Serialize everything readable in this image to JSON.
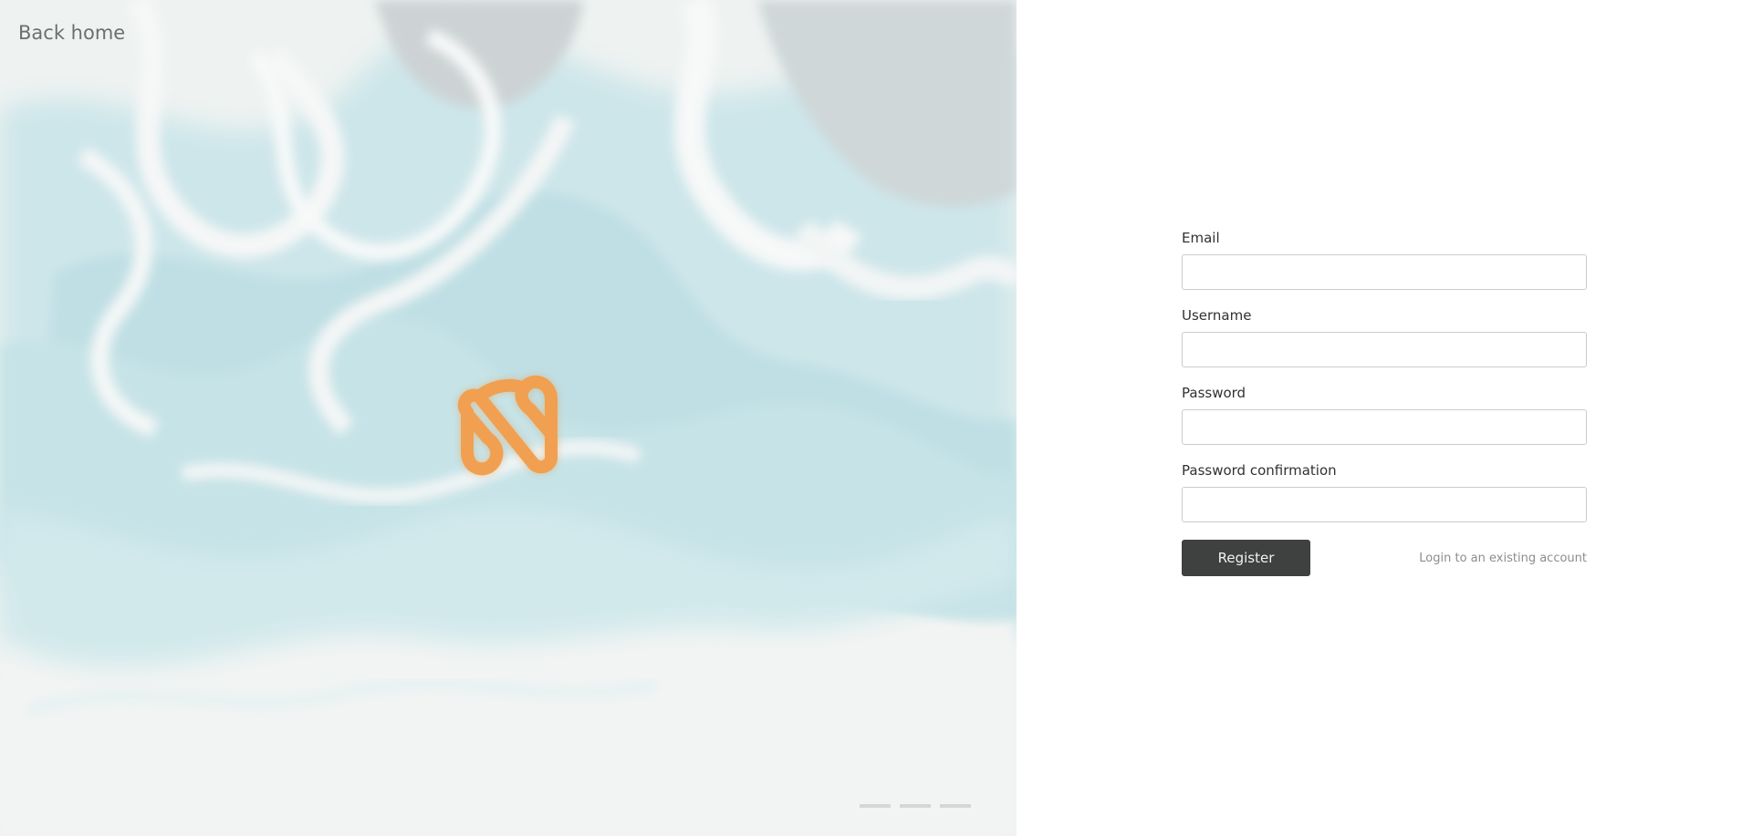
{
  "hero": {
    "back_link": "Back home",
    "logo_icon": "brand-n-logo-icon",
    "logo_color": "#F0A050",
    "slider_dots": [
      "slide-1",
      "slide-2",
      "slide-3"
    ]
  },
  "form": {
    "email_label": "Email",
    "email_value": "",
    "username_label": "Username",
    "username_value": "",
    "password_label": "Password",
    "password_value": "",
    "password_confirmation_label": "Password confirmation",
    "password_confirmation_value": "",
    "register_label": "Register",
    "login_link": "Login to an existing account"
  },
  "colors": {
    "button_bg": "#3F4141",
    "marble_blue": "#C8E4E8",
    "marble_white": "#F2F3F2"
  }
}
